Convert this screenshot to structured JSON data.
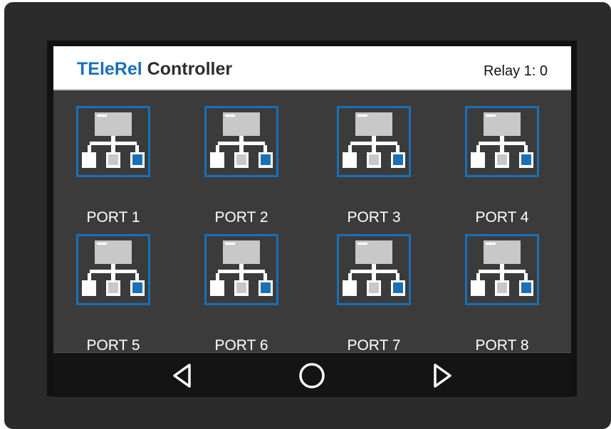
{
  "header": {
    "brand": "TEleRel",
    "title_rest": " Controller",
    "status": "Relay 1: 0"
  },
  "ports": [
    {
      "label": "PORT 1",
      "icon": "network-port-icon"
    },
    {
      "label": "PORT 2",
      "icon": "network-port-icon"
    },
    {
      "label": "PORT 3",
      "icon": "network-port-icon"
    },
    {
      "label": "PORT 4",
      "icon": "network-port-icon"
    },
    {
      "label": "PORT 5",
      "icon": "network-port-icon"
    },
    {
      "label": "PORT 6",
      "icon": "network-port-icon"
    },
    {
      "label": "PORT 7",
      "icon": "network-port-icon"
    },
    {
      "label": "PORT 8",
      "icon": "network-port-icon"
    }
  ],
  "nav": {
    "back_icon": "back-triangle-icon",
    "home_icon": "home-circle-icon",
    "forward_icon": "forward-triangle-icon"
  },
  "colors": {
    "accent": "#1a6fb7",
    "screen_bg": "#3b3b3b",
    "bezel": "#2b2b2b",
    "navbar": "#141414",
    "icon_gray": "#c8c8c8",
    "icon_white": "#ffffff"
  }
}
